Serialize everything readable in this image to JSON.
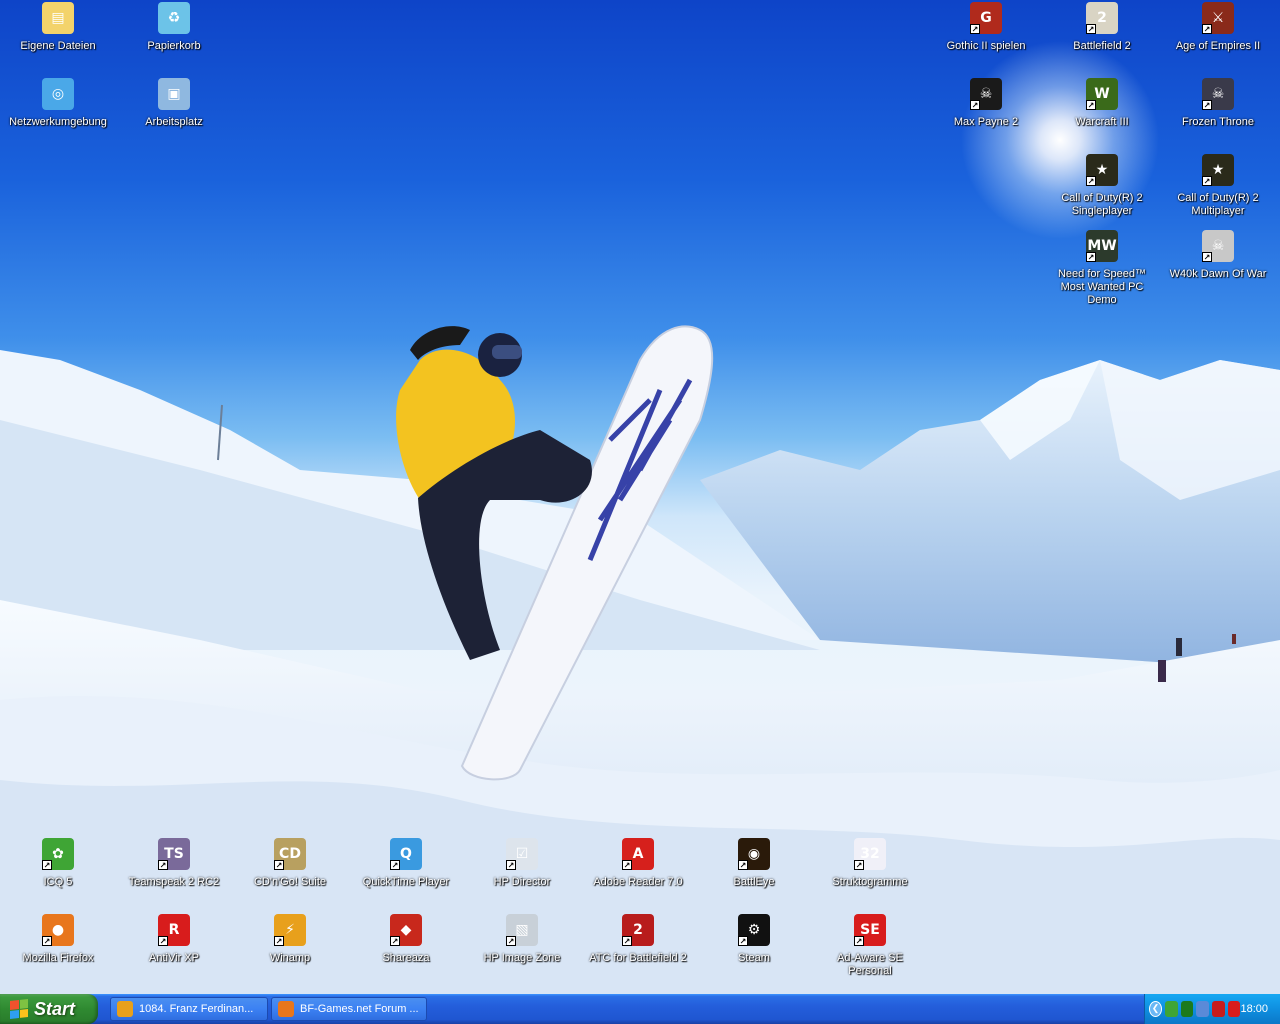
{
  "desktop": {
    "icons": [
      {
        "id": "eigene-dateien",
        "label": "Eigene Dateien",
        "icon": "folder-documents-icon",
        "shortcut": false,
        "color": "#f3d36b",
        "glyph": "▤"
      },
      {
        "id": "papierkorb",
        "label": "Papierkorb",
        "icon": "recycle-bin-icon",
        "shortcut": false,
        "color": "#6cc3e8",
        "glyph": "♻"
      },
      {
        "id": "netzwerkumgebung",
        "label": "Netzwerkumgebung",
        "icon": "network-places-icon",
        "shortcut": false,
        "color": "#4aa8e8",
        "glyph": "◎"
      },
      {
        "id": "arbeitsplatz",
        "label": "Arbeitsplatz",
        "icon": "my-computer-icon",
        "shortcut": false,
        "color": "#8fb8e0",
        "glyph": "▣"
      },
      {
        "id": "gothic-ii",
        "label": "Gothic II spielen",
        "icon": "gothic-ii-icon",
        "shortcut": true,
        "color": "#b02a1c",
        "glyph": "G"
      },
      {
        "id": "battlefield-2",
        "label": "Battlefield 2",
        "icon": "battlefield-2-icon",
        "shortcut": true,
        "color": "#d9d4c4",
        "glyph": "2"
      },
      {
        "id": "age-of-empires",
        "label": "Age of Empires II",
        "icon": "age-of-empires-icon",
        "shortcut": true,
        "color": "#8a2a1a",
        "glyph": "⚔"
      },
      {
        "id": "max-payne",
        "label": "Max Payne 2",
        "icon": "max-payne-icon",
        "shortcut": true,
        "color": "#1a1a1a",
        "glyph": "☠"
      },
      {
        "id": "warcraft-iii",
        "label": "Warcraft III",
        "icon": "warcraft-iii-icon",
        "shortcut": true,
        "color": "#3a6a1a",
        "glyph": "W"
      },
      {
        "id": "frozen-throne",
        "label": "Frozen Throne",
        "icon": "frozen-throne-icon",
        "shortcut": true,
        "color": "#3a3a4a",
        "glyph": "☠"
      },
      {
        "id": "cod2-single",
        "label": "Call of Duty(R) 2 Singleplayer",
        "icon": "call-of-duty-icon",
        "shortcut": true,
        "color": "#2a2a1a",
        "glyph": "★"
      },
      {
        "id": "cod2-multi",
        "label": "Call of Duty(R) 2 Multiplayer",
        "icon": "call-of-duty-icon",
        "shortcut": true,
        "color": "#2a2a1a",
        "glyph": "★"
      },
      {
        "id": "nfs-mw",
        "label": "Need for Speed™ Most Wanted PC Demo",
        "icon": "nfs-most-wanted-icon",
        "shortcut": true,
        "color": "#2c3a2c",
        "glyph": "MW"
      },
      {
        "id": "w40k",
        "label": "W40k Dawn Of War",
        "icon": "skull-icon",
        "shortcut": true,
        "color": "#c8c8c8",
        "glyph": "☠"
      },
      {
        "id": "icq",
        "label": "ICQ 5",
        "icon": "icq-flower-icon",
        "shortcut": true,
        "color": "#3fa535",
        "glyph": "✿"
      },
      {
        "id": "teamspeak",
        "label": "Teamspeak 2 RC2",
        "icon": "teamspeak-icon",
        "shortcut": true,
        "color": "#7a6a9a",
        "glyph": "TS"
      },
      {
        "id": "cdngo",
        "label": "CD'n'Go! Suite",
        "icon": "cd-disc-icon",
        "shortcut": true,
        "color": "#b8a060",
        "glyph": "CD"
      },
      {
        "id": "quicktime",
        "label": "QuickTime Player",
        "icon": "quicktime-icon",
        "shortcut": true,
        "color": "#3a9ae0",
        "glyph": "Q"
      },
      {
        "id": "hp-director",
        "label": "HP Director",
        "icon": "hp-director-icon",
        "shortcut": true,
        "color": "#dde4ec",
        "glyph": "☑"
      },
      {
        "id": "adobe-reader",
        "label": "Adobe Reader 7.0",
        "icon": "adobe-reader-icon",
        "shortcut": true,
        "color": "#d6201c",
        "glyph": "A"
      },
      {
        "id": "battleye",
        "label": "BattlEye",
        "icon": "battleye-icon",
        "shortcut": true,
        "color": "#2a1a0a",
        "glyph": "◉"
      },
      {
        "id": "struktogramme",
        "label": "Struktogramme",
        "icon": "struktogramme-icon",
        "shortcut": true,
        "color": "#f0f0f8",
        "glyph": "32"
      },
      {
        "id": "firefox",
        "label": "Mozilla Firefox",
        "icon": "firefox-icon",
        "shortcut": true,
        "color": "#e8761c",
        "glyph": "●"
      },
      {
        "id": "antivir",
        "label": "AntiVir XP",
        "icon": "antivir-icon",
        "shortcut": true,
        "color": "#d81c1c",
        "glyph": "R"
      },
      {
        "id": "winamp",
        "label": "Winamp",
        "icon": "winamp-icon",
        "shortcut": true,
        "color": "#e8a01c",
        "glyph": "⚡"
      },
      {
        "id": "shareaza",
        "label": "Shareaza",
        "icon": "shareaza-icon",
        "shortcut": true,
        "color": "#c8281c",
        "glyph": "◆"
      },
      {
        "id": "hp-image-zone",
        "label": "HP  Image Zone",
        "icon": "hp-image-zone-icon",
        "shortcut": true,
        "color": "#c8d0d8",
        "glyph": "▧"
      },
      {
        "id": "atc-bf2",
        "label": "ATC for Battlefield 2",
        "icon": "atc-battlefield-icon",
        "shortcut": true,
        "color": "#b81c1c",
        "glyph": "2"
      },
      {
        "id": "steam",
        "label": "Steam",
        "icon": "steam-icon",
        "shortcut": true,
        "color": "#111111",
        "glyph": "⚙"
      },
      {
        "id": "ad-aware",
        "label": "Ad-Aware SE Personal",
        "icon": "ad-aware-icon",
        "shortcut": true,
        "color": "#d81c1c",
        "glyph": "SE"
      }
    ]
  },
  "taskbar": {
    "start_label": "Start",
    "tasks": [
      {
        "label": "1084. Franz Ferdinan...",
        "icon": "winamp-icon",
        "color": "#e8a01c"
      },
      {
        "label": "BF-Games.net Forum ...",
        "icon": "firefox-icon",
        "color": "#e8761c"
      }
    ],
    "tray": {
      "icons": [
        {
          "name": "icq-tray-icon",
          "color": "#3fa535"
        },
        {
          "name": "eye-tray-icon",
          "color": "#1c7a1c"
        },
        {
          "name": "network-tray-icon",
          "color": "#5a8ad8"
        },
        {
          "name": "ati-tray-icon",
          "color": "#c81c1c"
        },
        {
          "name": "antivir-tray-icon",
          "color": "#d81c1c"
        }
      ],
      "clock": "18:00"
    }
  },
  "colors": {
    "taskbar_blue": "#245edb",
    "start_green": "#2f8a31",
    "tray_blue": "#0f8fe0"
  }
}
